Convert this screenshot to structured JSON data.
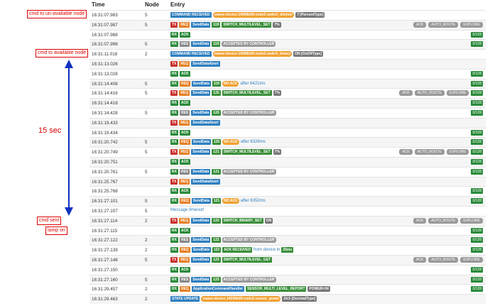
{
  "header": {
    "time": "Time",
    "node": "Node",
    "entry": "Entry"
  },
  "annotations": {
    "a1": "cmd to un-available node",
    "a2": "cmd to available node",
    "a3": "15 sec",
    "a4": "cmd sent",
    "a5": "lamp on"
  },
  "rows": [
    {
      "time": "16:31:07.983",
      "node": "5",
      "tags": [
        {
          "t": "COMMAND RECEIVED",
          "c": "blue"
        },
        {
          "t": "zwave:device:14599b09:node5:switch_dimmer",
          "c": "orange"
        },
        {
          "t": "7 [PercentType]",
          "c": "pct"
        }
      ],
      "right": []
    },
    {
      "time": "16:31:07.987",
      "node": "5",
      "tags": [
        {
          "t": "TX",
          "c": "tx"
        },
        {
          "t": "REQ",
          "c": "req"
        },
        {
          "t": "SendData",
          "c": "blue"
        },
        {
          "t": "119",
          "c": "green"
        },
        {
          "t": "SWITCH_MULTILEVEL_SET",
          "c": "green"
        },
        {
          "t": "7%",
          "c": "pct"
        }
      ],
      "right": [
        "ACK",
        "AUTO_ROUTE",
        "EXPLORE"
      ],
      "count": ""
    },
    {
      "time": "16:31:07.988",
      "node": "",
      "tags": [
        {
          "t": "RX",
          "c": "rx"
        },
        {
          "t": "ACK",
          "c": "ack"
        }
      ],
      "right": [],
      "count": "0/128"
    },
    {
      "time": "16:31:07.998",
      "node": "5",
      "tags": [
        {
          "t": "RX",
          "c": "rx"
        },
        {
          "t": "RES",
          "c": "res"
        },
        {
          "t": "SendData",
          "c": "blue"
        },
        {
          "t": "119",
          "c": "green"
        },
        {
          "t": "ACCEPTED BY CONTROLLER",
          "c": "grey"
        }
      ],
      "right": [],
      "count": "0/128"
    },
    {
      "time": "16:31:11.018",
      "node": "2",
      "tags": [
        {
          "t": "COMMAND RECEIVED",
          "c": "blue"
        },
        {
          "t": "zwave:device:14599b09:node2:switch_binary",
          "c": "orange"
        },
        {
          "t": "ON [OnOffType]",
          "c": "pct"
        }
      ],
      "right": [],
      "count": ""
    },
    {
      "time": "16:31:13.026",
      "node": "",
      "tags": [
        {
          "t": "TX",
          "c": "tx"
        },
        {
          "t": "REQ",
          "c": "req"
        },
        {
          "t": "SendDataAbort",
          "c": "blue"
        }
      ],
      "right": [],
      "count": ""
    },
    {
      "time": "16:31:13.028",
      "node": "",
      "tags": [
        {
          "t": "RX",
          "c": "rx"
        },
        {
          "t": "ACK",
          "c": "ack"
        }
      ],
      "right": [],
      "count": "0/128"
    },
    {
      "time": "16:31:14.408",
      "node": "5",
      "tags": [
        {
          "t": "RX",
          "c": "rx"
        },
        {
          "t": "REQ",
          "c": "req"
        },
        {
          "t": "SendData",
          "c": "blue"
        },
        {
          "t": "119",
          "c": "green"
        },
        {
          "t": "NO ACK",
          "c": "orange"
        },
        {
          "t": "after 6421ms",
          "c": "txt"
        }
      ],
      "right": [],
      "count": "0/128"
    },
    {
      "time": "16:31:14.416",
      "node": "5",
      "tags": [
        {
          "t": "TX",
          "c": "tx"
        },
        {
          "t": "REQ",
          "c": "req"
        },
        {
          "t": "SendData",
          "c": "blue"
        },
        {
          "t": "120",
          "c": "green"
        },
        {
          "t": "SWITCH_MULTILEVEL_SET",
          "c": "green"
        },
        {
          "t": "7%",
          "c": "pct"
        }
      ],
      "right": [
        "ACK",
        "AUTO_ROUTE",
        "EXPLORE"
      ],
      "count": "0/128"
    },
    {
      "time": "16:31:14.418",
      "node": "",
      "tags": [
        {
          "t": "RX",
          "c": "rx"
        },
        {
          "t": "ACK",
          "c": "ack"
        }
      ],
      "right": [],
      "count": "0/128"
    },
    {
      "time": "16:31:14.428",
      "node": "5",
      "tags": [
        {
          "t": "RX",
          "c": "rx"
        },
        {
          "t": "RES",
          "c": "res"
        },
        {
          "t": "SendData",
          "c": "blue"
        },
        {
          "t": "120",
          "c": "green"
        },
        {
          "t": "ACCEPTED BY CONTROLLER",
          "c": "grey"
        }
      ],
      "right": [],
      "count": "0/128"
    },
    {
      "time": "16:31:19.433",
      "node": "",
      "tags": [
        {
          "t": "TX",
          "c": "tx"
        },
        {
          "t": "REQ",
          "c": "req"
        },
        {
          "t": "SendDataAbort",
          "c": "blue"
        }
      ],
      "right": [],
      "count": ""
    },
    {
      "time": "16:31:19.434",
      "node": "",
      "tags": [
        {
          "t": "RX",
          "c": "rx"
        },
        {
          "t": "ACK",
          "c": "ack"
        }
      ],
      "right": [],
      "count": "0/128"
    },
    {
      "time": "16:31:20.742",
      "node": "5",
      "tags": [
        {
          "t": "RX",
          "c": "rx"
        },
        {
          "t": "REQ",
          "c": "req"
        },
        {
          "t": "SendData",
          "c": "blue"
        },
        {
          "t": "120",
          "c": "green"
        },
        {
          "t": "NO ACK",
          "c": "orange"
        },
        {
          "t": "after 6326ms",
          "c": "txt"
        }
      ],
      "right": [],
      "count": "0/128"
    },
    {
      "time": "16:31:20.749",
      "node": "5",
      "tags": [
        {
          "t": "TX",
          "c": "tx"
        },
        {
          "t": "REQ",
          "c": "req"
        },
        {
          "t": "SendData",
          "c": "blue"
        },
        {
          "t": "121",
          "c": "green"
        },
        {
          "t": "SWITCH_MULTILEVEL_SET",
          "c": "green"
        },
        {
          "t": "7%",
          "c": "pct"
        }
      ],
      "right": [
        "ACK",
        "AUTO_ROUTE",
        "EXPLORE"
      ],
      "count": "0/128"
    },
    {
      "time": "16:31:20.751",
      "node": "",
      "tags": [
        {
          "t": "RX",
          "c": "rx"
        },
        {
          "t": "ACK",
          "c": "ack"
        }
      ],
      "right": [],
      "count": "0/128"
    },
    {
      "time": "16:31:20.761",
      "node": "5",
      "tags": [
        {
          "t": "RX",
          "c": "rx"
        },
        {
          "t": "RES",
          "c": "res"
        },
        {
          "t": "SendData",
          "c": "blue"
        },
        {
          "t": "121",
          "c": "green"
        },
        {
          "t": "ACCEPTED BY CONTROLLER",
          "c": "grey"
        }
      ],
      "right": [],
      "count": "0/128"
    },
    {
      "time": "16:31:25.767",
      "node": "",
      "tags": [
        {
          "t": "TX",
          "c": "tx"
        },
        {
          "t": "REQ",
          "c": "req"
        },
        {
          "t": "SendDataAbort",
          "c": "blue"
        }
      ],
      "right": [],
      "count": ""
    },
    {
      "time": "16:31:25.768",
      "node": "",
      "tags": [
        {
          "t": "RX",
          "c": "rx"
        },
        {
          "t": "ACK",
          "c": "ack"
        }
      ],
      "right": [],
      "count": "0/128"
    },
    {
      "time": "16:31:27.101",
      "node": "5",
      "tags": [
        {
          "t": "RX",
          "c": "rx"
        },
        {
          "t": "REQ",
          "c": "req"
        },
        {
          "t": "SendData",
          "c": "blue"
        },
        {
          "t": "121",
          "c": "green"
        },
        {
          "t": "NO ACK",
          "c": "orange"
        },
        {
          "t": "after 6352ms",
          "c": "txt"
        }
      ],
      "right": [],
      "count": "0/128"
    },
    {
      "time": "16:31:27.107",
      "node": "5",
      "tags": [
        {
          "t": "Message timeout!",
          "c": "txt"
        }
      ],
      "right": [],
      "count": ""
    },
    {
      "time": "16:31:27.114",
      "node": "2",
      "tags": [
        {
          "t": "TX",
          "c": "tx"
        },
        {
          "t": "REQ",
          "c": "req"
        },
        {
          "t": "SendData",
          "c": "blue"
        },
        {
          "t": "122",
          "c": "green"
        },
        {
          "t": "SWITCH_BINARY_SET",
          "c": "green"
        },
        {
          "t": "ON",
          "c": "pct"
        }
      ],
      "right": [
        "ACK",
        "AUTO_ROUTE",
        "EXPLORE"
      ],
      "count": ""
    },
    {
      "time": "16:31:27.115",
      "node": "",
      "tags": [
        {
          "t": "RX",
          "c": "rx"
        },
        {
          "t": "ACK",
          "c": "ack"
        }
      ],
      "right": [],
      "count": "0/128"
    },
    {
      "time": "16:31:27.122",
      "node": "2",
      "tags": [
        {
          "t": "RX",
          "c": "rx"
        },
        {
          "t": "RES",
          "c": "res"
        },
        {
          "t": "SendData",
          "c": "blue"
        },
        {
          "t": "122",
          "c": "green"
        },
        {
          "t": "ACCEPTED BY CONTROLLER",
          "c": "grey"
        }
      ],
      "right": [],
      "count": "0/128"
    },
    {
      "time": "16:31:27.139",
      "node": "2",
      "tags": [
        {
          "t": "RX",
          "c": "rx"
        },
        {
          "t": "REQ",
          "c": "req"
        },
        {
          "t": "SendData",
          "c": "blue"
        },
        {
          "t": "122",
          "c": "green"
        },
        {
          "t": "ACK RECEIVED",
          "c": "green"
        },
        {
          "t": "from device in",
          "c": "txt"
        },
        {
          "t": "25ms",
          "c": "green"
        }
      ],
      "right": [],
      "count": "0/128"
    },
    {
      "time": "16:31:27.148",
      "node": "5",
      "tags": [
        {
          "t": "TX",
          "c": "tx"
        },
        {
          "t": "REQ",
          "c": "req"
        },
        {
          "t": "SendData",
          "c": "blue"
        },
        {
          "t": "123",
          "c": "green"
        },
        {
          "t": "SWITCH_MULTILEVEL_GET",
          "c": "green"
        }
      ],
      "right": [
        "ACK",
        "AUTO_ROUTE",
        "EXPLORE"
      ],
      "count": ""
    },
    {
      "time": "16:31:27.150",
      "node": "",
      "tags": [
        {
          "t": "RX",
          "c": "rx"
        },
        {
          "t": "ACK",
          "c": "ack"
        }
      ],
      "right": [],
      "count": "0/128"
    },
    {
      "time": "16:31:27.160",
      "node": "5",
      "tags": [
        {
          "t": "RX",
          "c": "rx"
        },
        {
          "t": "RES",
          "c": "res"
        },
        {
          "t": "SendData",
          "c": "blue"
        },
        {
          "t": "123",
          "c": "green"
        },
        {
          "t": "ACCEPTED BY CONTROLLER",
          "c": "grey"
        }
      ],
      "right": [],
      "count": "0/128"
    },
    {
      "time": "16:31:29.457",
      "node": "2",
      "tags": [
        {
          "t": "RX",
          "c": "rx"
        },
        {
          "t": "REQ",
          "c": "req"
        },
        {
          "t": "ApplicationCommandHandler",
          "c": "blue"
        },
        {
          "t": "SENSOR_MULTI_LEVEL_REPORT",
          "c": "green"
        },
        {
          "t": "POWER=34",
          "c": "pct"
        }
      ],
      "right": [],
      "count": "0/128"
    },
    {
      "time": "16:31:29.463",
      "node": "2",
      "tags": [
        {
          "t": "STATE UPDATE",
          "c": "blue"
        },
        {
          "t": "zwave:device:14599b09:node2:sensor_power",
          "c": "orange"
        },
        {
          "t": "24.5 [DecimalType]",
          "c": "pct"
        }
      ],
      "right": [],
      "count": ""
    }
  ]
}
